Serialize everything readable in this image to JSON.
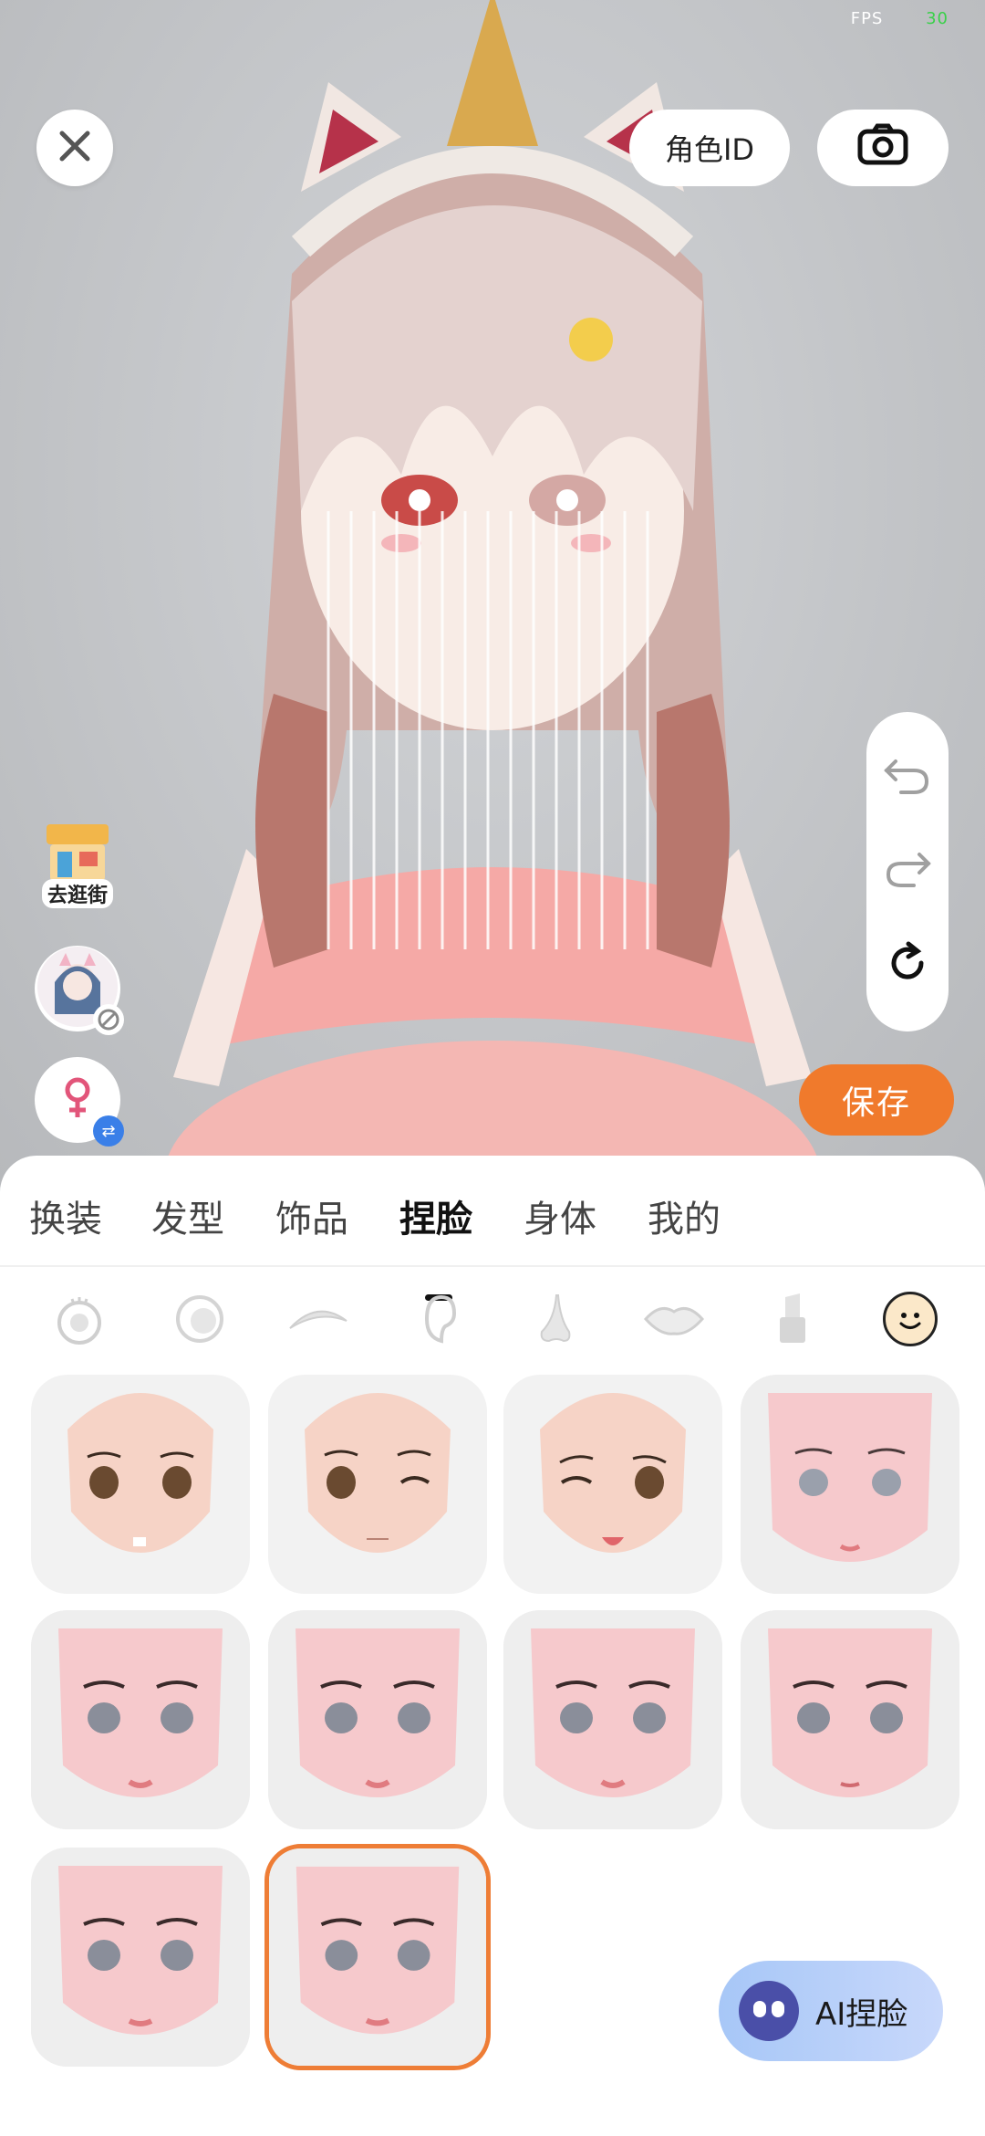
{
  "status": {
    "fps_label": "FPS",
    "fps_value": "30"
  },
  "top_bar": {
    "role_id_label": "角色ID"
  },
  "left_shortcuts": {
    "shop_label": "去逛街"
  },
  "save_label": "保存",
  "tabs": [
    {
      "label": "换装"
    },
    {
      "label": "发型"
    },
    {
      "label": "饰品"
    },
    {
      "label": "捏脸"
    },
    {
      "label": "身体"
    },
    {
      "label": "我的"
    }
  ],
  "active_tab": "捏脸",
  "subcategories": [
    "eye-icon",
    "pupil-icon",
    "eyebrow-icon",
    "ear-icon",
    "nose-icon",
    "lips-icon",
    "lipstick-icon",
    "face-expression-icon"
  ],
  "selected_face_index": 9,
  "ai_button_label": "AI捏脸",
  "colors": {
    "accent": "#f07a2c",
    "selected_border": "#ee7d36",
    "fps_value": "#3ad04a"
  }
}
